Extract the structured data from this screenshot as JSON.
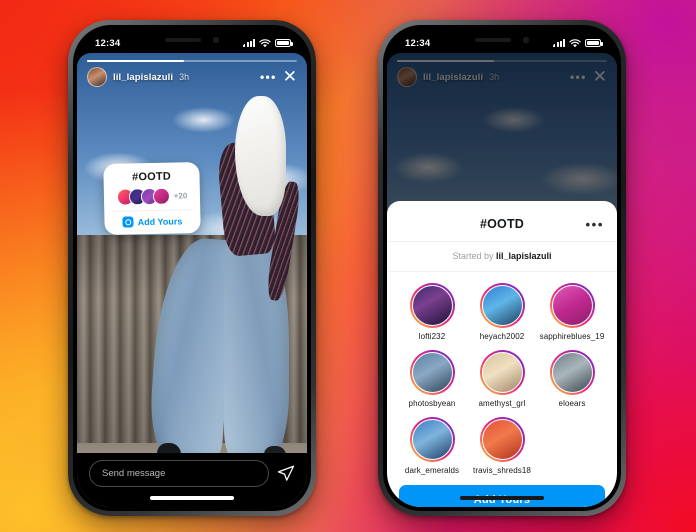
{
  "background": {
    "gradient_colors": [
      "#F5350F",
      "#FB8F1E",
      "#FDC02A",
      "#E32C68",
      "#C2129B",
      "#F40B23"
    ]
  },
  "theme": {
    "accent": "#0095F6",
    "story_ring_gradient": [
      "#f9ce34",
      "#ee2a7b",
      "#6228d7"
    ],
    "sheet_bg": "#FFFFFF"
  },
  "status_bar": {
    "time": "12:34",
    "signal_icon": "cellular-bars-icon",
    "wifi_icon": "wifi-icon",
    "battery_icon": "battery-icon"
  },
  "left_phone": {
    "story": {
      "username": "lil_lapislazuli",
      "timestamp": "3h",
      "more_icon": "ellipsis-icon",
      "close_icon": "close-icon",
      "avatar_name": "story-author-avatar"
    },
    "sticker": {
      "title": "#OOTD",
      "extra_count": "+20",
      "cta_label": "Add Yours",
      "cta_icon": "camera-icon",
      "face_count": 4
    },
    "message_bar": {
      "placeholder": "Send message",
      "send_icon": "send-paper-plane-icon"
    }
  },
  "right_phone": {
    "story": {
      "username": "lil_lapislazuli",
      "timestamp": "3h",
      "more_icon": "ellipsis-icon",
      "close_icon": "close-icon"
    },
    "sheet": {
      "title": "#OOTD",
      "menu_icon": "ellipsis-icon",
      "started_prefix": "Started by",
      "started_by": "lil_lapislazuli",
      "participants": [
        {
          "username": "lofti232"
        },
        {
          "username": "heyach2002"
        },
        {
          "username": "sapphireblues_19"
        },
        {
          "username": "photosbyean"
        },
        {
          "username": "amethyst_grl"
        },
        {
          "username": "eloears"
        },
        {
          "username": "dark_emeralds"
        },
        {
          "username": "travis_shreds18"
        }
      ],
      "cta_label": "Add Yours"
    }
  }
}
